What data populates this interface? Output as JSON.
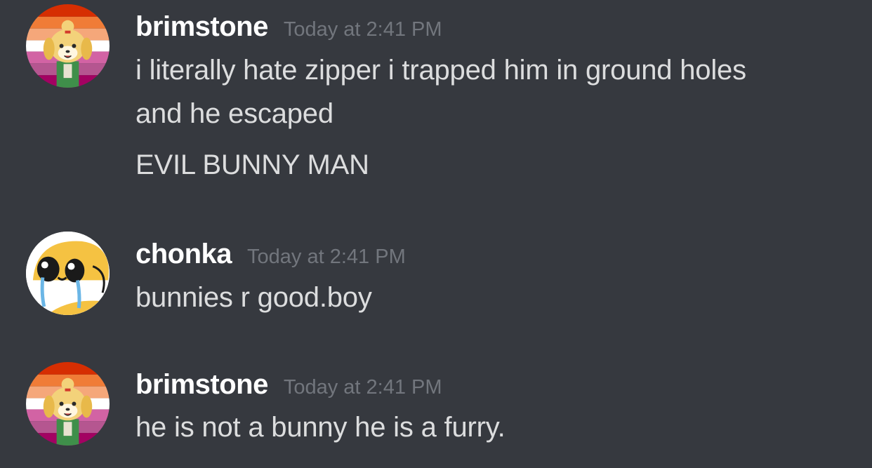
{
  "messages": [
    {
      "author": "brimstone",
      "timestamp": "Today at 2:41 PM",
      "avatar_icon": "isabelle-lesbian-flag-avatar",
      "lines": [
        "i literally hate zipper i trapped him in ground holes",
        "and he escaped",
        "EVIL BUNNY MAN"
      ]
    },
    {
      "author": "chonka",
      "timestamp": "Today at 2:41 PM",
      "avatar_icon": "crying-yellow-face-avatar",
      "lines": [
        "bunnies r good.boy"
      ]
    },
    {
      "author": "brimstone",
      "timestamp": "Today at 2:41 PM",
      "avatar_icon": "isabelle-lesbian-flag-avatar",
      "lines": [
        "he is not a bunny he is a furry."
      ]
    }
  ],
  "colors": {
    "background": "#36393f",
    "username": "#ffffff",
    "timestamp": "#72767d",
    "message_text": "#dcddde"
  }
}
